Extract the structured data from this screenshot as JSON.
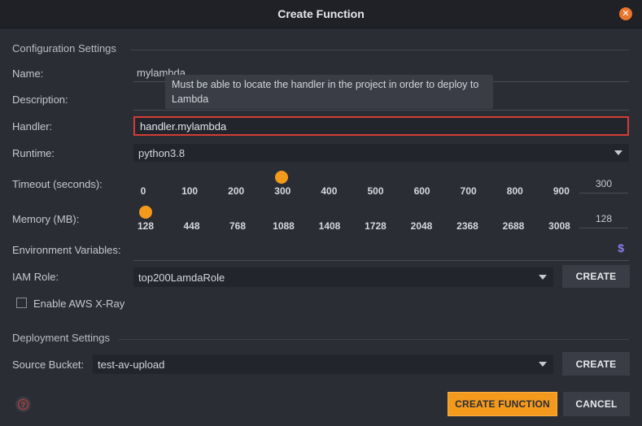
{
  "dialog": {
    "title": "Create Function"
  },
  "config": {
    "section_title": "Configuration Settings",
    "name_label": "Name:",
    "name_value": "mylambda",
    "description_label": "Description:",
    "handler_label": "Handler:",
    "handler_value": "handler.mylambda",
    "handler_tooltip": "Must be able to locate the handler in the project in order to deploy to Lambda",
    "runtime_label": "Runtime:",
    "runtime_value": "python3.8",
    "timeout_label": "Timeout (seconds):",
    "timeout_ticks": [
      "0",
      "100",
      "200",
      "300",
      "400",
      "500",
      "600",
      "700",
      "800",
      "900"
    ],
    "timeout_value": "300",
    "memory_label": "Memory (MB):",
    "memory_ticks": [
      "128",
      "448",
      "768",
      "1088",
      "1408",
      "1728",
      "2048",
      "2368",
      "2688",
      "3008"
    ],
    "memory_value": "128",
    "env_label": "Environment Variables:",
    "env_icon": "dollar-icon",
    "iam_label": "IAM Role:",
    "iam_value": "top200LamdaRole",
    "iam_create": "CREATE",
    "xray_label": "Enable AWS X-Ray",
    "xray_checked": false
  },
  "deploy": {
    "section_title": "Deployment Settings",
    "bucket_label": "Source Bucket:",
    "bucket_value": "test-av-upload",
    "bucket_create": "CREATE"
  },
  "footer": {
    "help_icon": "help-icon",
    "create_function": "CREATE FUNCTION",
    "cancel": "CANCEL"
  },
  "colors": {
    "accent": "#f39a1d",
    "error_border": "#d33c35",
    "background": "#2b2d35"
  }
}
